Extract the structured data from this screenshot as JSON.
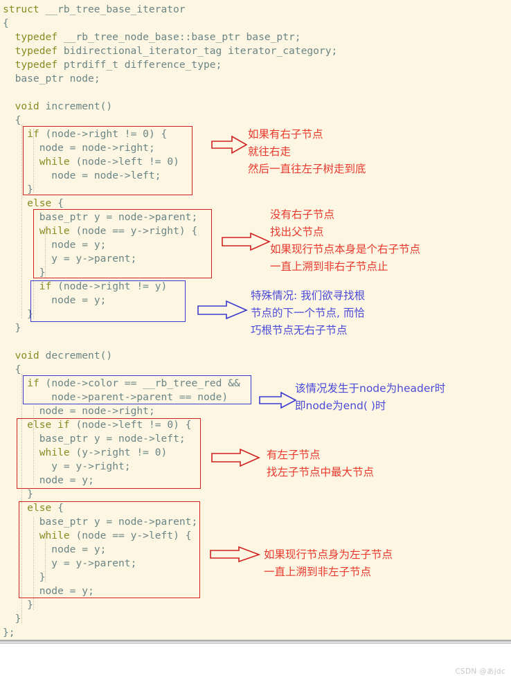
{
  "editor": {
    "background_color": "#fdf6e3",
    "keyword_color": "#8a8a23",
    "identifier_color": "#6a8585",
    "code_lines": [
      "struct __rb_tree_base_iterator",
      "{",
      "  typedef __rb_tree_node_base::base_ptr base_ptr;",
      "  typedef bidirectional_iterator_tag iterator_category;",
      "  typedef ptrdiff_t difference_type;",
      "  base_ptr node;",
      "",
      "  void increment()",
      "  {",
      "    if (node->right != 0) {",
      "      node = node->right;",
      "      while (node->left != 0)",
      "        node = node->left;",
      "    }",
      "    else {",
      "      base_ptr y = node->parent;",
      "      while (node == y->right) {",
      "        node = y;",
      "        y = y->parent;",
      "      }",
      "      if (node->right != y)",
      "        node = y;",
      "    }",
      "  }",
      "",
      "  void decrement()",
      "  {",
      "    if (node->color == __rb_tree_red &&",
      "        node->parent->parent == node)",
      "      node = node->right;",
      "    else if (node->left != 0) {",
      "      base_ptr y = node->left;",
      "      while (y->right != 0)",
      "        y = y->right;",
      "      node = y;",
      "    }",
      "    else {",
      "      base_ptr y = node->parent;",
      "      while (node == y->left) {",
      "        node = y;",
      "        y = y->parent;",
      "      }",
      "      node = y;",
      "    }",
      "  }",
      "};"
    ]
  },
  "highlights": [
    {
      "name": "increment-if-right-box",
      "color": "#d02020"
    },
    {
      "name": "increment-else-parent-box",
      "color": "#d02020"
    },
    {
      "name": "increment-root-special-box",
      "color": "#3a3ad0"
    },
    {
      "name": "decrement-header-check-box",
      "color": "#3a3ad0"
    },
    {
      "name": "decrement-else-if-left-box",
      "color": "#d02020"
    },
    {
      "name": "decrement-else-parent-box",
      "color": "#d02020"
    }
  ],
  "annotations": [
    {
      "id": "note-increment-has-right-child",
      "color": "#e8392e",
      "arrow_color": "#d02020",
      "lines": [
        "如果有右子节点",
        "就往右走",
        "然后一直往左子树走到底"
      ]
    },
    {
      "id": "note-increment-no-right-child",
      "color": "#e8392e",
      "arrow_color": "#d02020",
      "lines": [
        "没有右子节点",
        "找出父节点",
        "如果现行节点本身是个右子节点",
        "一直上溯到非右子节点止"
      ]
    },
    {
      "id": "note-increment-special-root",
      "color": "#4a4ad8",
      "arrow_color": "#3a3ad0",
      "lines": [
        "特殊情况: 我们欲寻找根",
        "节点的下一个节点, 而恰",
        "巧根节点无右子节点"
      ]
    },
    {
      "id": "note-decrement-header-case",
      "color": "#4a4ad8",
      "arrow_color": "#3a3ad0",
      "lines": [
        "该情况发生于node为header时",
        "即node为end( )时"
      ]
    },
    {
      "id": "note-decrement-has-left-child",
      "color": "#e8392e",
      "arrow_color": "#d02020",
      "lines": [
        "有左子节点",
        "找左子节点中最大节点"
      ]
    },
    {
      "id": "note-decrement-is-left-child",
      "color": "#e8392e",
      "arrow_color": "#d02020",
      "lines": [
        "如果现行节点身为左子节点",
        "一直上溯到非左子节点"
      ]
    }
  ],
  "watermark": {
    "text": "CSDN @あjdc"
  }
}
